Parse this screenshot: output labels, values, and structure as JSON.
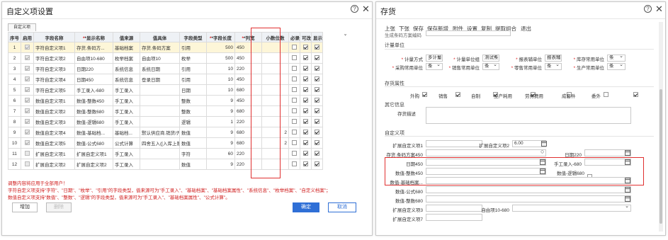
{
  "left": {
    "title": "自定义项设置",
    "tab": "自定义项",
    "columns": [
      "序号",
      "启用",
      "字段名称",
      "*显示名称",
      "值来源",
      "值具体",
      "字段类型",
      "*字段长度",
      "*列宽",
      "小数位数",
      "必录",
      "可改",
      "显示"
    ],
    "rows": [
      {
        "n": "1",
        "enabled": true,
        "field": "字符自定义项1",
        "display": "存货.条码方...",
        "source": "基础档案",
        "detail": "存货.条码方案",
        "type": "引用",
        "len": "500",
        "width": "450",
        "dec": "",
        "req": false,
        "edit": true,
        "show": true
      },
      {
        "n": "2",
        "enabled": true,
        "field": "字符自定义项2",
        "display": "自由项10-680",
        "source": "枚举档案",
        "detail": "自由项10",
        "type": "枚举",
        "len": "500",
        "width": "450",
        "dec": "",
        "req": false,
        "edit": true,
        "show": true
      },
      {
        "n": "3",
        "enabled": true,
        "field": "字符自定义项3",
        "display": "日期220",
        "source": "系统信息",
        "detail": "系统日期",
        "type": "引用",
        "len": "10",
        "width": "220",
        "dec": "",
        "req": false,
        "edit": true,
        "show": true
      },
      {
        "n": "4",
        "enabled": true,
        "field": "字符自定义项4",
        "display": "日期450",
        "source": "系统信息",
        "detail": "登录日期",
        "type": "引用",
        "len": "10",
        "width": "450",
        "dec": "",
        "req": false,
        "edit": true,
        "show": true
      },
      {
        "n": "5",
        "enabled": true,
        "field": "字符自定义项5",
        "display": "手工录入-680",
        "source": "手工录入",
        "detail": "",
        "type": "日期",
        "len": "10",
        "width": "680",
        "dec": "",
        "req": false,
        "edit": true,
        "show": true
      },
      {
        "n": "6",
        "enabled": true,
        "field": "数值自定义项1",
        "display": "数值-整数450",
        "source": "手工录入",
        "detail": "",
        "type": "整数",
        "len": "9",
        "width": "450",
        "dec": "",
        "req": false,
        "edit": true,
        "show": true
      },
      {
        "n": "7",
        "enabled": true,
        "field": "数值自定义项2",
        "display": "数值-整数680",
        "source": "手工录入",
        "detail": "",
        "type": "整数",
        "len": "9",
        "width": "680",
        "dec": "",
        "req": false,
        "edit": true,
        "show": true
      },
      {
        "n": "8",
        "enabled": true,
        "field": "数值自定义项3",
        "display": "数值-逻辑680",
        "source": "手工录入",
        "detail": "",
        "type": "逻辑",
        "len": "1",
        "width": "220",
        "dec": "",
        "req": false,
        "edit": true,
        "show": true
      },
      {
        "n": "9",
        "enabled": true,
        "field": "数值自定义项4",
        "display": "数值-基础档...",
        "source": "基础档...",
        "detail": "默认供应商.销货/开...",
        "type": "数值",
        "len": "9",
        "width": "680",
        "dec": "2",
        "req": false,
        "edit": true,
        "show": true
      },
      {
        "n": "10",
        "enabled": true,
        "field": "数值自定义项5",
        "display": "数值-公式680",
        "source": "公式计算",
        "detail": "四舍五入([入库上限...",
        "type": "数值",
        "len": "9",
        "width": "680",
        "dec": "2",
        "req": false,
        "edit": true,
        "show": true
      },
      {
        "n": "11",
        "enabled": false,
        "field": "扩展自定义项1",
        "display": "扩展自定义项1",
        "source": "手工录入",
        "detail": "",
        "type": "字符",
        "len": "60",
        "width": "220",
        "dec": "",
        "req": false,
        "edit": true,
        "show": true
      },
      {
        "n": "12",
        "enabled": false,
        "field": "扩展自定义项2",
        "display": "扩展自定义项2",
        "source": "手工录入",
        "detail": "",
        "type": "数值",
        "len": "9",
        "width": "220",
        "dec": "",
        "req": false,
        "edit": true,
        "show": true
      }
    ],
    "notes": [
      "调整内容将应用于全部用户！",
      "字符自定义项支持\"字符\"、\"日期\"、\"枚举\"、\"引用\"的字段类型，值来源可为\"手工录入\"、\"基础档案\"、\"基础档案属性\"、\"系统信息\"、\"枚举档案\"、\"自定义档案\"；",
      "数值自定义项支持\"数值\"、\"整数\"、\"逻辑\"的字段类型，值来源可为\"手工录入\"、\"基础档案属性\"、\"公式计算\"。"
    ],
    "buttons": {
      "add": "增加",
      "delete": "删除",
      "ok": "确定",
      "cancel": "取消"
    }
  },
  "right": {
    "title": "存货",
    "menu": [
      "上张",
      "下张",
      "保存",
      "保存新增",
      "附件",
      "设置",
      "复制",
      "提取组合",
      "退出"
    ],
    "cutoff_label": "生成条码方案编码",
    "measure_section": "计量单位",
    "measure_rows": [
      [
        {
          "label": "计量方式",
          "value": "多计量"
        },
        {
          "label": "计量单位组",
          "value": "测试条"
        },
        {
          "label": "报表辅单位",
          "value": "报表辅"
        },
        {
          "label": "库存常用单位",
          "value": "条"
        }
      ],
      [
        {
          "label": "采购常用单位",
          "value": "条"
        },
        {
          "label": "销售常用单位",
          "value": "条"
        },
        {
          "label": "零售常用单位",
          "value": "条"
        },
        {
          "label": "生产常用单位",
          "value": "条"
        }
      ]
    ],
    "attr_section": "存货属性",
    "attrs": [
      {
        "label": "外购",
        "checked": true
      },
      {
        "label": "销售",
        "checked": true
      },
      {
        "label": "自制",
        "checked": true
      },
      {
        "label": "生产耗用",
        "checked": true
      },
      {
        "label": "劳务费用",
        "checked": false
      },
      {
        "label": "成套件",
        "checked": false
      },
      {
        "label": "委外",
        "checked": true
      }
    ],
    "other_section": "其它信息",
    "desc_label": "存货描述",
    "custom_section": "自定义项",
    "custom": {
      "ext2_label": "扩展自定义项1",
      "ext2_value": "",
      "extnum_label": "扩展自定义项2",
      "extnum_value": "6.00",
      "barcode_label": "存货.条码方案450",
      "date220_label": "日期220",
      "date450_label": "日期450",
      "manual680_label": "手工录入-680",
      "int450_label": "数值-整数450",
      "logic680_label": "数值-逻辑680",
      "basic680_label": "数值-基础档案...",
      "formula680_label": "数值-公式680",
      "int680_label": "数值-整数680",
      "ext3_label": "扩展自定义项3",
      "free10_label": "自由项10-680",
      "ext7_label": "扩展自定义项7"
    }
  },
  "colors": {
    "accent": "#2f6fd6",
    "highlight": "#e03030",
    "selected_row": "#fdf6d8"
  }
}
